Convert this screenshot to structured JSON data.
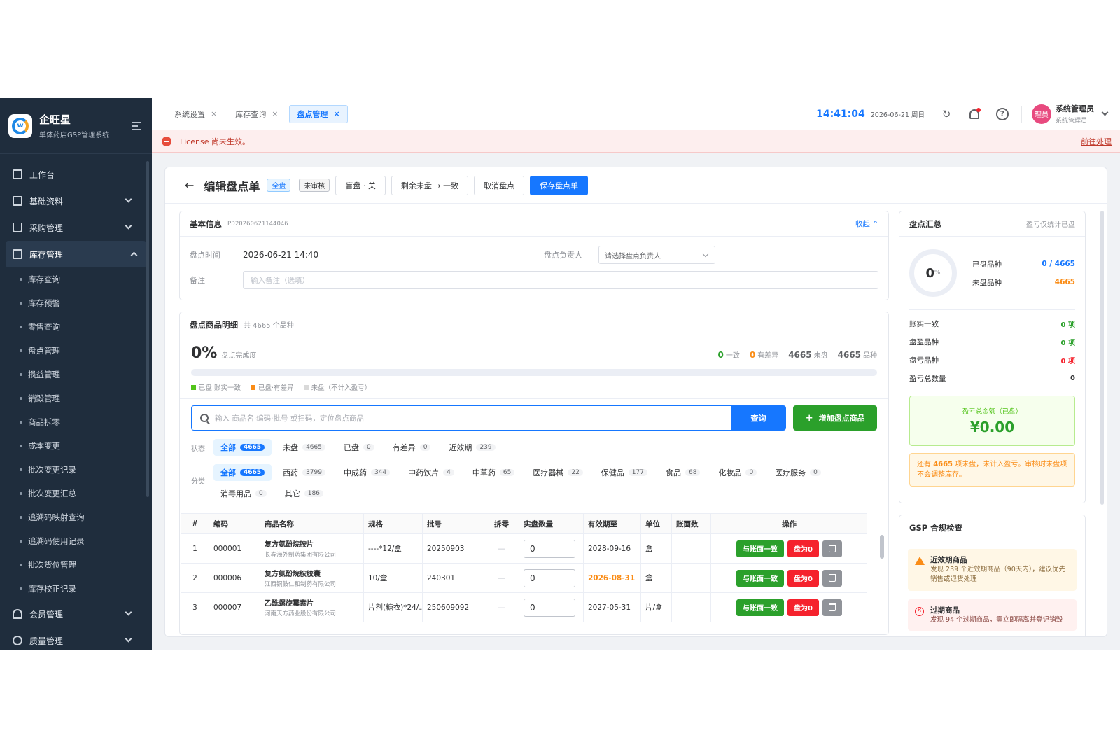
{
  "brand": {
    "name": "企旺星",
    "subtitle": "单体药店GSP管理系统",
    "logo_letter": "w"
  },
  "sidebar": {
    "items": [
      {
        "label": "工作台",
        "icon": "dashboard-icon"
      },
      {
        "label": "基础资料",
        "icon": "grid-icon"
      },
      {
        "label": "采购管理",
        "icon": "cart-icon"
      },
      {
        "label": "库存管理",
        "icon": "inventory-icon"
      },
      {
        "label": "会员管理",
        "icon": "users-icon"
      },
      {
        "label": "质量管理",
        "icon": "quality-icon"
      }
    ],
    "sub_items": [
      "库存查询",
      "库存预警",
      "零售查询",
      "盘点管理",
      "损益管理",
      "销毁管理",
      "商品拆零",
      "成本变更",
      "批次变更记录",
      "批次变更汇总",
      "追溯码映射查询",
      "追溯码使用记录",
      "批次货位管理",
      "库存校正记录"
    ]
  },
  "tabs": [
    {
      "label": "系统设置"
    },
    {
      "label": "库存查询"
    },
    {
      "label": "盘点管理"
    }
  ],
  "header": {
    "time": "14:41:04",
    "date": "2026-06-21 周日",
    "user_name": "系统管理员",
    "user_role": "系统管理员",
    "avatar_text": "理员"
  },
  "license": {
    "message": "License 尚未生效。",
    "link": "前往处理"
  },
  "page": {
    "title": "编辑盘点单",
    "tag_type": "全盘",
    "tag_status": "未审核",
    "buttons": {
      "blind": "盲盘 · 关",
      "remaining": "剩余未盘 → 一致",
      "cancel": "取消盘点",
      "save": "保存盘点单"
    }
  },
  "basic": {
    "title": "基本信息",
    "doc_no": "PD20260621144046",
    "collapse": "收起",
    "time_label": "盘点时间",
    "time_value": "2026-06-21 14:40",
    "owner_label": "盘点负责人",
    "owner_placeholder": "请选择盘点负责人",
    "remark_label": "备注",
    "remark_placeholder": "输入备注（选填）"
  },
  "detail": {
    "title": "盘点商品明细",
    "count_text": "共 4665 个品种",
    "progress_pct": "0%",
    "progress_label": "盘点完成度",
    "progress_fraction": 0,
    "stats": [
      {
        "num": "0",
        "label": "一致",
        "color": "#2ba02b"
      },
      {
        "num": "0",
        "label": "有差异",
        "color": "#fa8c16"
      },
      {
        "num": "4665",
        "label": "未盘",
        "color": "#606266"
      },
      {
        "num": "4665",
        "label": "品种",
        "color": "#606266"
      }
    ],
    "legend": [
      {
        "label": "已盘·账实一致",
        "color": "#52c41a"
      },
      {
        "label": "已盘·有差异",
        "color": "#fa8c16"
      },
      {
        "label": "未盘（不计入盈亏）",
        "color": "#d9d9d9"
      }
    ],
    "search_placeholder": "输入 商品名·编码·批号 或扫码，定位盘点商品",
    "search_button": "查询",
    "add_button": "增加盘点商品",
    "status_label": "状态",
    "status_chips": [
      {
        "label": "全部",
        "count": "4665"
      },
      {
        "label": "未盘",
        "count": "4665"
      },
      {
        "label": "已盘",
        "count": "0"
      },
      {
        "label": "有差异",
        "count": "0"
      },
      {
        "label": "近效期",
        "count": "239"
      }
    ],
    "category_label": "分类",
    "category_chips": [
      {
        "label": "全部",
        "count": "4665"
      },
      {
        "label": "西药",
        "count": "3799"
      },
      {
        "label": "中成药",
        "count": "344"
      },
      {
        "label": "中药饮片",
        "count": "4"
      },
      {
        "label": "中草药",
        "count": "65"
      },
      {
        "label": "医疗器械",
        "count": "22"
      },
      {
        "label": "保健品",
        "count": "177"
      },
      {
        "label": "食品",
        "count": "68"
      },
      {
        "label": "化妆品",
        "count": "0"
      },
      {
        "label": "医疗服务",
        "count": "0"
      },
      {
        "label": "消毒用品",
        "count": "0"
      },
      {
        "label": "其它",
        "count": "186"
      }
    ],
    "columns": [
      "#",
      "编码",
      "商品名称",
      "规格",
      "批号",
      "拆零",
      "实盘数量",
      "有效期至",
      "单位",
      "账面数",
      "操作"
    ],
    "rows": [
      {
        "no": "1",
        "code": "000001",
        "name": "复方氨酚烷胺片",
        "maker": "长春海外制药集团有限公司",
        "spec": "----*12/盒",
        "batch": "20250903",
        "split": "—",
        "qty": "0",
        "expiry": "2028-09-16",
        "unit": "盒"
      },
      {
        "no": "2",
        "code": "000006",
        "name": "复方氨酚烷胺胶囊",
        "maker": "江西铜鼓仁和制药有限公司",
        "spec": "10/盒",
        "batch": "240301",
        "split": "—",
        "qty": "0",
        "expiry": "2026-08-31",
        "unit": "盒"
      },
      {
        "no": "3",
        "code": "000007",
        "name": "乙酰螺旋霉素片",
        "maker": "河南天方药业股份有限公司",
        "spec": "片剂(糖衣)*24/...",
        "batch": "250609092",
        "split": "—",
        "qty": "0",
        "expiry": "2027-05-31",
        "unit": "片/盒"
      }
    ],
    "action_match": "与账面一致",
    "action_zero": "盘为0"
  },
  "summary": {
    "title": "盘点汇总",
    "note": "盈亏仅统计已盘",
    "ring_value": "0",
    "ring_unit": "%",
    "done_label": "已盘品种",
    "done_value": "0 / 4665",
    "undone_label": "未盘品种",
    "undone_value": "4665",
    "lines": [
      {
        "label": "账实一致",
        "value": "0 项",
        "color": "#2ba02b"
      },
      {
        "label": "盘盈品种",
        "value": "0 项",
        "color": "#2ba02b"
      },
      {
        "label": "盘亏品种",
        "value": "0 项",
        "color": "#f5222d"
      },
      {
        "label": "盈亏总数量",
        "value": "0",
        "color": "#303133"
      }
    ],
    "amount_label": "盈亏总金额（已盘）",
    "amount_value": "¥0.00",
    "warn_pre": "还有 ",
    "warn_num": "4665",
    "warn_post": " 项未盘，未计入盈亏。审核时未盘项不会调整库存。"
  },
  "gsp": {
    "title": "GSP 合规检查",
    "items": [
      {
        "title": "近效期商品",
        "desc": "发现 239 个近效期商品（90天内），建议优先销售或退货处理"
      },
      {
        "title": "过期商品",
        "desc": "发现 94 个过期商品，需立即隔离并登记销毁"
      }
    ]
  }
}
